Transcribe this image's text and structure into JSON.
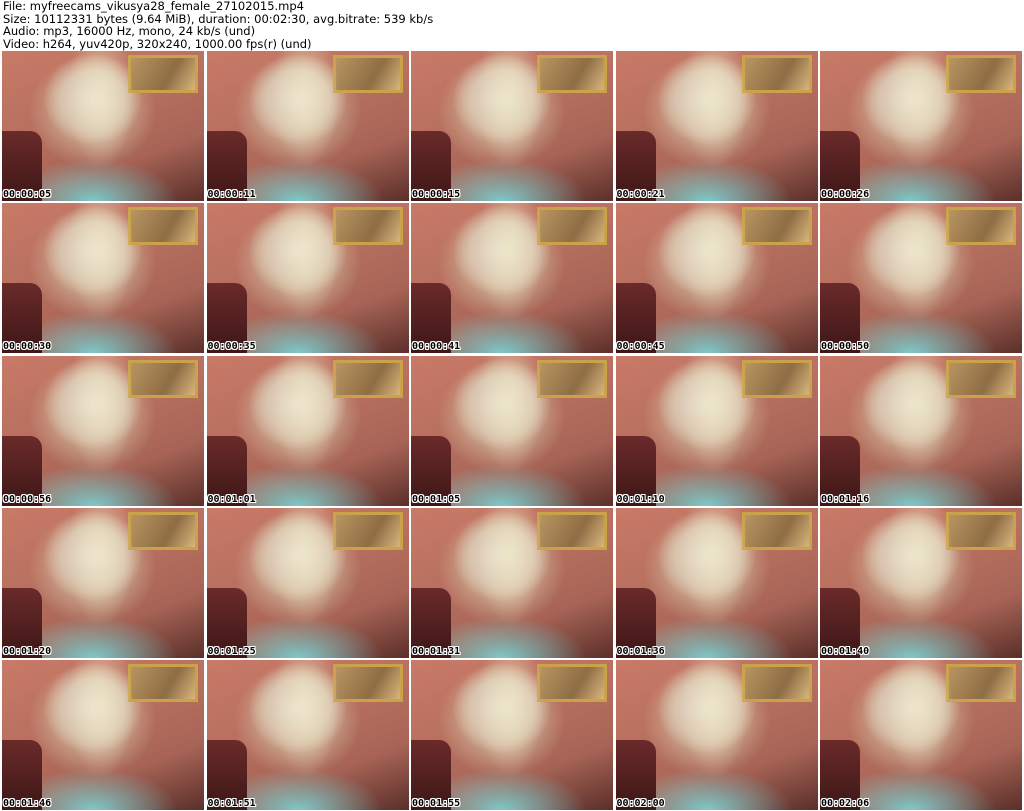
{
  "header": {
    "line1": "File: myfreecams_vikusya28_female_27102015.mp4",
    "line2": "Size: 10112331 bytes (9.64 MiB), duration: 00:02:30, avg.bitrate: 539 kb/s",
    "line3": "Audio: mp3, 16000 Hz, mono, 24 kb/s (und)",
    "line4": "Video: h264, yuv420p, 320x240, 1000.00 fps(r) (und)"
  },
  "thumbnails": [
    {
      "timestamp": "00:00:05"
    },
    {
      "timestamp": "00:00:11"
    },
    {
      "timestamp": "00:00:15"
    },
    {
      "timestamp": "00:00:21"
    },
    {
      "timestamp": "00:00:26"
    },
    {
      "timestamp": "00:00:30"
    },
    {
      "timestamp": "00:00:35"
    },
    {
      "timestamp": "00:00:41"
    },
    {
      "timestamp": "00:00:45"
    },
    {
      "timestamp": "00:00:50"
    },
    {
      "timestamp": "00:00:56"
    },
    {
      "timestamp": "00:01:01"
    },
    {
      "timestamp": "00:01:05"
    },
    {
      "timestamp": "00:01:10"
    },
    {
      "timestamp": "00:01:16"
    },
    {
      "timestamp": "00:01:20"
    },
    {
      "timestamp": "00:01:25"
    },
    {
      "timestamp": "00:01:31"
    },
    {
      "timestamp": "00:01:36"
    },
    {
      "timestamp": "00:01:40"
    },
    {
      "timestamp": "00:01:46"
    },
    {
      "timestamp": "00:01:51"
    },
    {
      "timestamp": "00:01:55"
    },
    {
      "timestamp": "00:02:00"
    },
    {
      "timestamp": "00:02:06"
    }
  ]
}
